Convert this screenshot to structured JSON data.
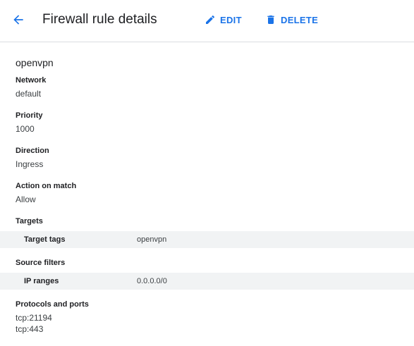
{
  "header": {
    "title": "Firewall rule details",
    "edit_label": "EDIT",
    "delete_label": "DELETE",
    "accent_color": "#1a73e8"
  },
  "rule": {
    "name": "openvpn",
    "network": {
      "label": "Network",
      "value": "default"
    },
    "priority": {
      "label": "Priority",
      "value": "1000"
    },
    "direction": {
      "label": "Direction",
      "value": "Ingress"
    },
    "action": {
      "label": "Action on match",
      "value": "Allow"
    },
    "targets": {
      "label": "Targets",
      "key": "Target tags",
      "value": "openvpn"
    },
    "source_filters": {
      "label": "Source filters",
      "key": "IP ranges",
      "value": "0.0.0.0/0"
    },
    "protocols": {
      "label": "Protocols and ports",
      "items": [
        "tcp:21194",
        "tcp:443"
      ]
    }
  },
  "icons": {
    "back": "arrow-back-icon",
    "edit": "pencil-icon",
    "delete": "trash-icon"
  }
}
